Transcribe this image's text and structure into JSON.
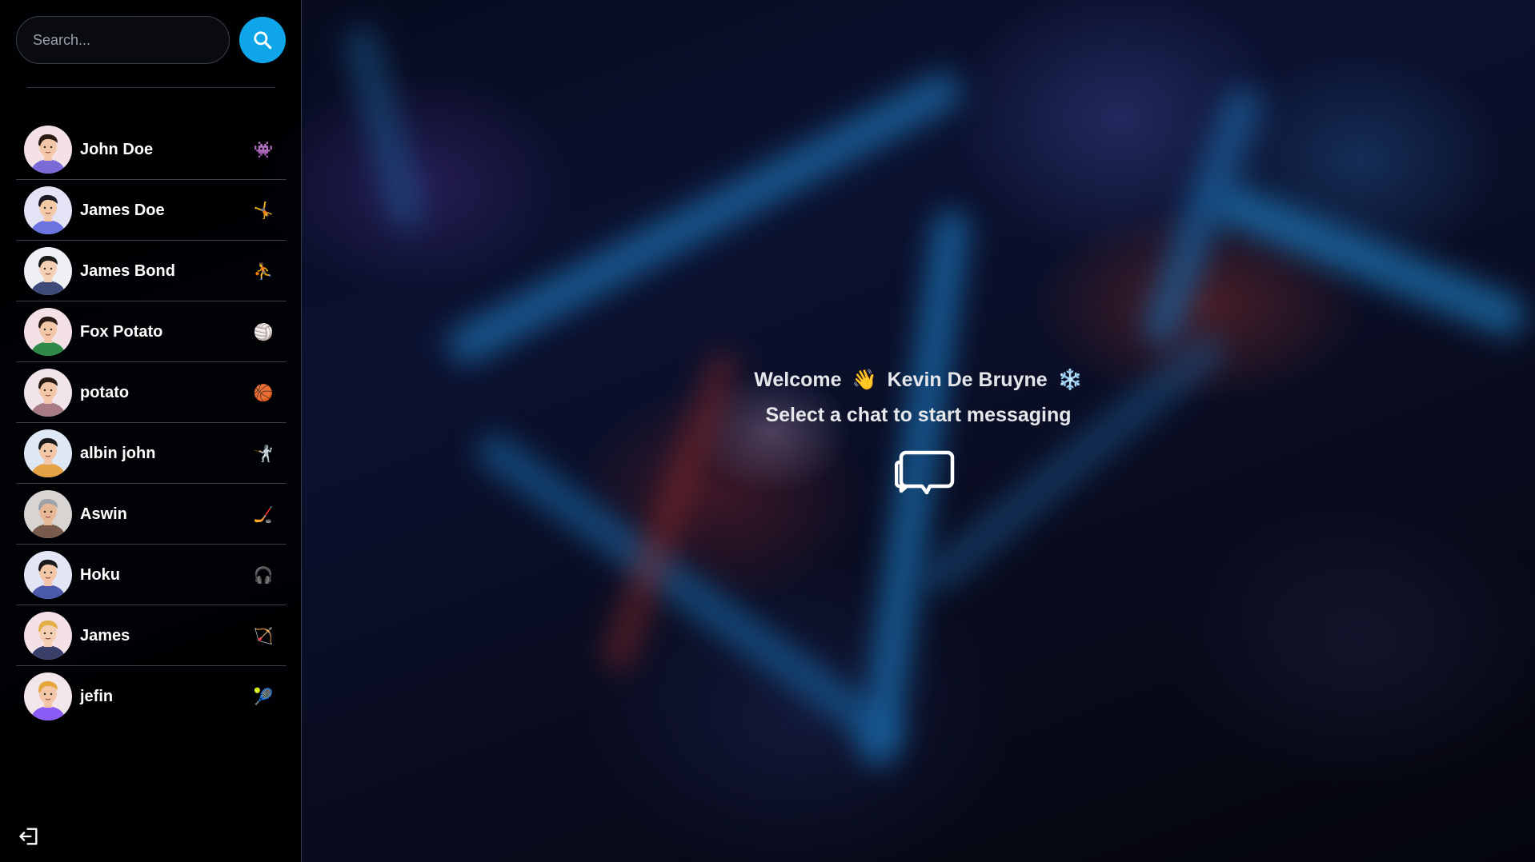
{
  "search": {
    "placeholder": "Search..."
  },
  "contacts": [
    {
      "name": "John Doe",
      "emoji": "👾",
      "skin": "#f2c6a6",
      "shirt": "#7a6bd6",
      "hair": "#2a1a14",
      "bg": "#f3e1e6"
    },
    {
      "name": "James Doe",
      "emoji": "🤸",
      "skin": "#f3c9a8",
      "shirt": "#6b74e0",
      "hair": "#1c1a24",
      "bg": "#e4e2f5"
    },
    {
      "name": "James Bond",
      "emoji": "⛹️",
      "skin": "#f5cfb3",
      "shirt": "#3d4a7a",
      "hair": "#1a1a1a",
      "bg": "#eef0f5"
    },
    {
      "name": "Fox Potato",
      "emoji": "🏐",
      "skin": "#f2c6a6",
      "shirt": "#2f8a4a",
      "hair": "#2a1a14",
      "bg": "#f3e1e6"
    },
    {
      "name": "potato",
      "emoji": "🏀",
      "skin": "#f2c6a6",
      "shirt": "#a87a86",
      "hair": "#2a1a14",
      "bg": "#f0e3ea"
    },
    {
      "name": "albin john",
      "emoji": "🤺",
      "skin": "#f2c6a6",
      "shirt": "#e3a245",
      "hair": "#1a1a1a",
      "bg": "#dfe8f5"
    },
    {
      "name": "Aswin",
      "emoji": "🏒",
      "skin": "#e6b896",
      "shirt": "#7a5a4a",
      "hair": "#9ea2a8",
      "bg": "#d8d4d2"
    },
    {
      "name": "Hoku",
      "emoji": "🎧",
      "skin": "#f2c6a6",
      "shirt": "#4a5aa8",
      "hair": "#1a1a1a",
      "bg": "#e3e6f5"
    },
    {
      "name": "James",
      "emoji": "🏹",
      "skin": "#f5cfb3",
      "shirt": "#3a3f6a",
      "hair": "#e3b048",
      "bg": "#f3e1e6"
    },
    {
      "name": "jefin",
      "emoji": "🎾",
      "skin": "#f2c6a6",
      "shirt": "#8b5cf6",
      "hair": "#e5a63a",
      "bg": "#f3e6ea"
    }
  ],
  "welcome": {
    "greeting": "Welcome",
    "wave": "👋",
    "user": "Kevin De Bruyne",
    "snow": "❄️",
    "subtitle": "Select a chat to start messaging"
  },
  "icons": {
    "search": "search-icon",
    "logout": "logout-icon",
    "chat": "chat-bubbles-icon"
  },
  "colors": {
    "accent": "#0ea5e9",
    "sidebar_bg": "#000000",
    "text": "#e5e7eb"
  }
}
